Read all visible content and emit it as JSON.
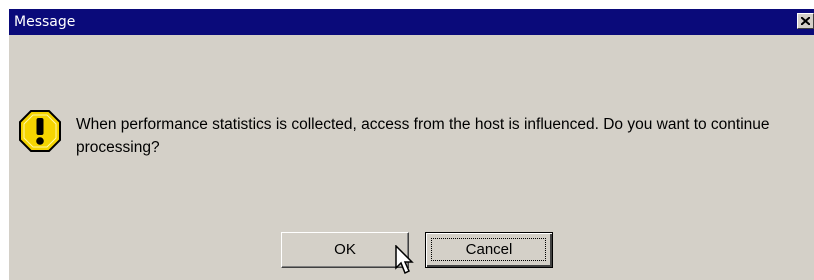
{
  "window": {
    "title": "Message",
    "close_icon": "close-icon"
  },
  "dialog": {
    "icon": "warning-icon",
    "message": "When performance statistics is collected, access from the host is influenced. Do you want to continue processing?"
  },
  "buttons": {
    "ok_label": "OK",
    "cancel_label": "Cancel"
  },
  "colors": {
    "titlebar": "#0a0a7a",
    "dialog_bg": "#d4d0c8",
    "warning": "#f5d400"
  }
}
